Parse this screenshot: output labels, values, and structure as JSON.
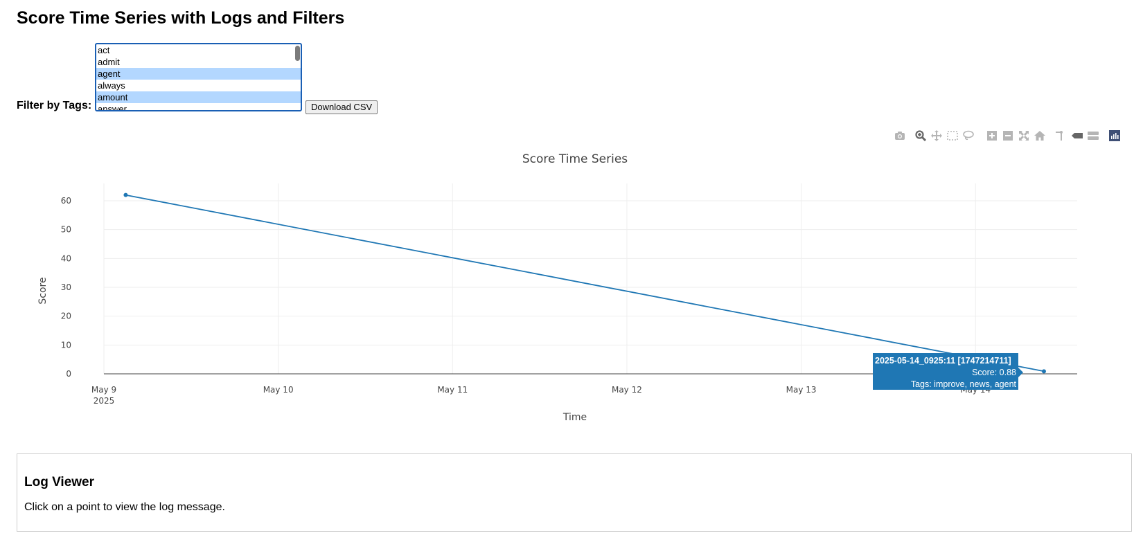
{
  "page": {
    "title": "Score Time Series with Logs and Filters"
  },
  "filter": {
    "label": "Filter by Tags:",
    "tags": [
      {
        "label": "act",
        "selected": false
      },
      {
        "label": "admit",
        "selected": false
      },
      {
        "label": "agent",
        "selected": true
      },
      {
        "label": "always",
        "selected": false
      },
      {
        "label": "amount",
        "selected": true
      },
      {
        "label": "answer",
        "selected": false
      }
    ],
    "download_label": "Download CSV"
  },
  "modebar": {
    "icons": [
      "camera-icon",
      "zoom-icon",
      "pan-icon",
      "box-select-icon",
      "lasso-select-icon",
      "zoom-in-icon",
      "zoom-out-icon",
      "autoscale-icon",
      "reset-axes-icon",
      "spike-lines-icon",
      "hover-closest-icon",
      "hover-compare-icon",
      "plotly-logo-icon"
    ],
    "active_icon": "zoom-icon",
    "color": "#b5b5b5",
    "active_color": "#666666"
  },
  "chart_data": {
    "type": "line",
    "title": "Score Time Series",
    "xlabel": "Time",
    "ylabel": "Score",
    "x_ticks": [
      "May 9\n2025",
      "May 10",
      "May 11",
      "May 12",
      "May 13",
      "May 14"
    ],
    "x_tick_dates": [
      "2025-05-09",
      "2025-05-10",
      "2025-05-11",
      "2025-05-12",
      "2025-05-13",
      "2025-05-14"
    ],
    "xlim": [
      "2025-05-09T00:00:00",
      "2025-05-14T14:00:00"
    ],
    "y_ticks": [
      0,
      10,
      20,
      30,
      40,
      50,
      60
    ],
    "ylim": [
      0,
      66
    ],
    "grid": true,
    "line_color": "#1f77b4",
    "series": [
      {
        "x": [
          "2025-05-09T03:00:00",
          "2025-05-14T09:25:11"
        ],
        "y": [
          62,
          0.88
        ]
      }
    ],
    "hover": {
      "title": "2025-05-14_0925:11 [1747214711]",
      "score": "Score: 0.88",
      "tags": "Tags: improve, news, agent"
    }
  },
  "log_viewer": {
    "heading": "Log Viewer",
    "message": "Click on a point to view the log message."
  }
}
